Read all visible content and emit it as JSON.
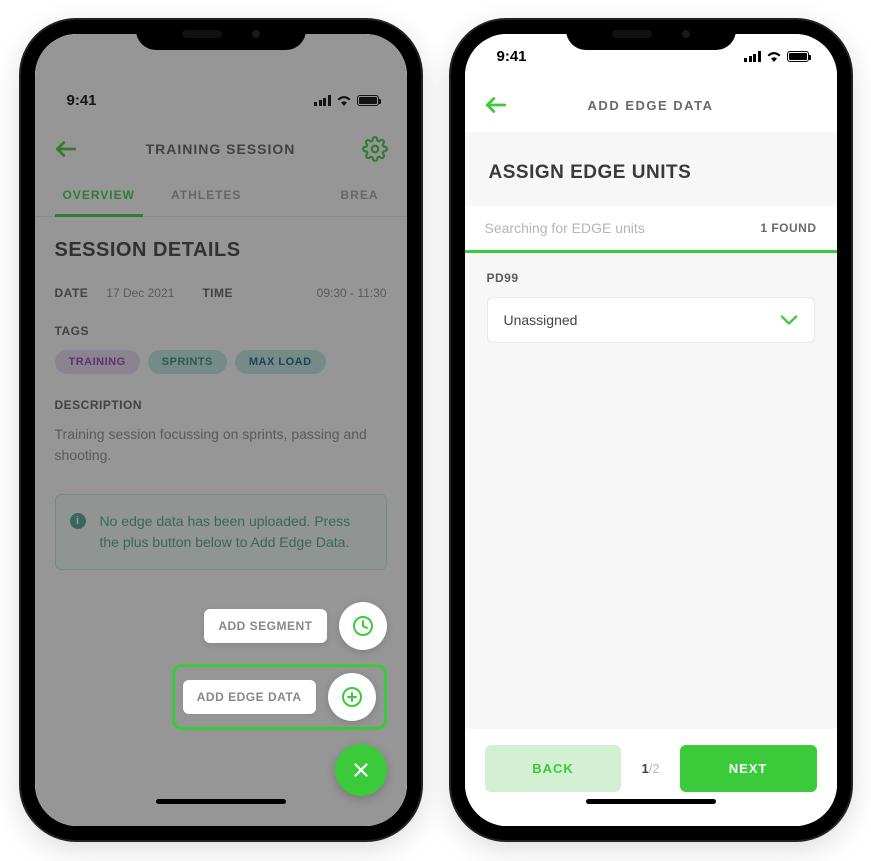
{
  "status": {
    "time": "9:41"
  },
  "screen1": {
    "header": {
      "title": "TRAINING SESSION"
    },
    "tabs": {
      "overview": "OVERVIEW",
      "athletes": "ATHLETES",
      "breakdown": "BREA"
    },
    "section_title": "SESSION DETAILS",
    "date": {
      "label": "DATE",
      "value": "17 Dec 2021"
    },
    "time": {
      "label": "TIME",
      "value": "09:30 - 11:30"
    },
    "tags_label": "TAGS",
    "tags": {
      "training": "TRAINING",
      "sprints": "SPRINTS",
      "max_load": "MAX LOAD"
    },
    "description_label": "DESCRIPTION",
    "description_text": "Training session focussing on sprints, passing and shooting.",
    "info_text": "No edge data has been uploaded. Press the plus button below to Add Edge Data.",
    "fab": {
      "add_segment": "ADD SEGMENT",
      "add_edge_data": "ADD EDGE DATA"
    }
  },
  "screen2": {
    "header": {
      "title": "ADD EDGE DATA"
    },
    "section_title": "ASSIGN EDGE UNITS",
    "search": {
      "placeholder": "Searching for EDGE units",
      "found": "1 FOUND"
    },
    "unit": {
      "id": "PD99",
      "assignment": "Unassigned"
    },
    "footer": {
      "back": "BACK",
      "step_current": "1",
      "step_total": "/2",
      "next": "NEXT"
    }
  }
}
